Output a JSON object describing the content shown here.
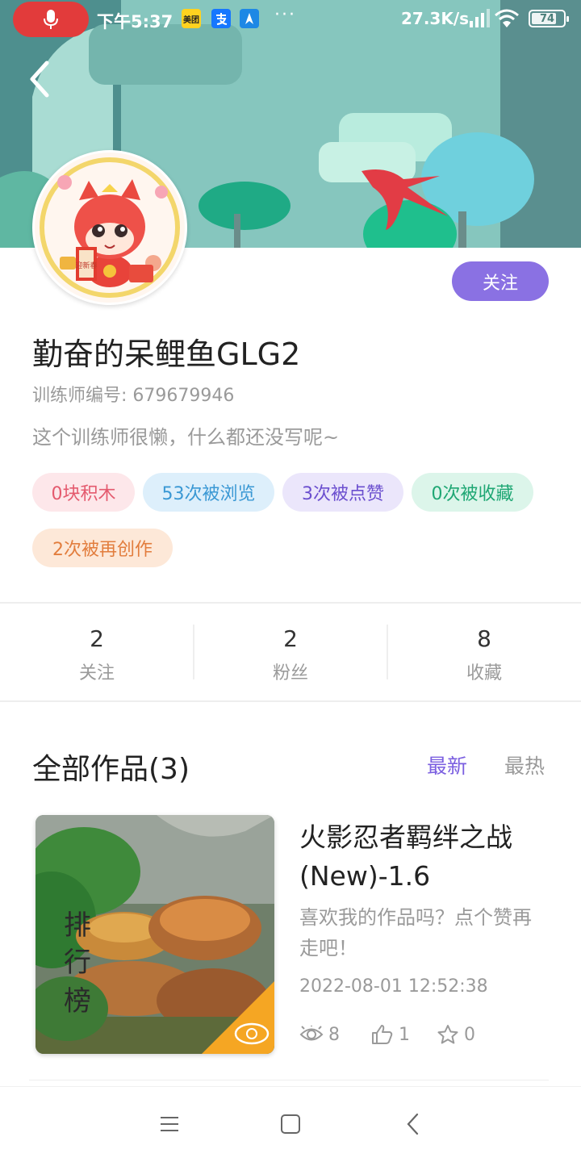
{
  "status_bar": {
    "time": "下午5:37",
    "network_speed": "27.3K/s",
    "battery": "74",
    "app_icons": [
      "meituan-icon",
      "alipay-icon",
      "map-icon"
    ],
    "meituan_text": "美团",
    "more": "···"
  },
  "profile": {
    "follow_label": "关注",
    "username": "勤奋的呆鲤鱼GLG2",
    "trainer_id": "训练师编号: 679679946",
    "bio": "这个训练师很懒，什么都还没写呢~",
    "tags": [
      {
        "label": "0块积木"
      },
      {
        "label": "53次被浏览"
      },
      {
        "label": "3次被点赞"
      },
      {
        "label": "0次被收藏"
      },
      {
        "label": "2次被再创作"
      }
    ],
    "avatar_text": "迎新春"
  },
  "stats": [
    {
      "value": "2",
      "label": "关注"
    },
    {
      "value": "2",
      "label": "粉丝"
    },
    {
      "value": "8",
      "label": "收藏"
    }
  ],
  "works": {
    "title": "全部作品(3)",
    "sort_new": "最新",
    "sort_hot": "最热",
    "items": [
      {
        "thumb_text": [
          "排",
          "行",
          "榜"
        ],
        "title": "火影忍者羁绊之战(New)-1.6",
        "desc": "喜欢我的作品吗？点个赞再走吧！",
        "date": "2022-08-01 12:52:38",
        "views": "8",
        "likes": "1",
        "stars": "0"
      }
    ]
  },
  "colors": {
    "accent": "#8a71e3",
    "sort_active": "#7b5fe0",
    "status_pill": "#e23b3b"
  }
}
